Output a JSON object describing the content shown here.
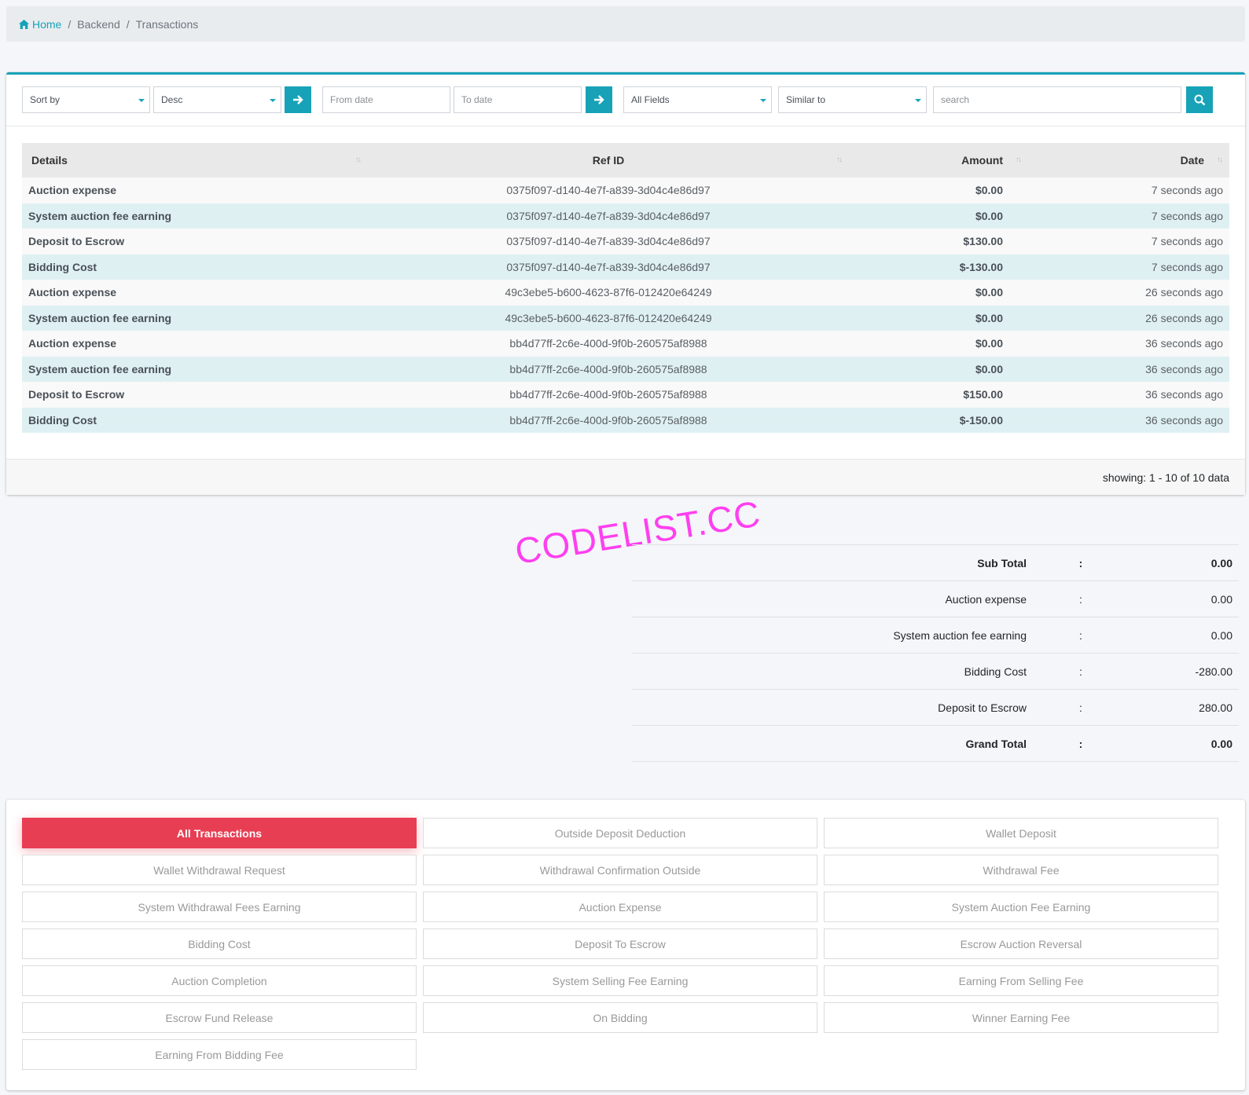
{
  "breadcrumb": {
    "home": "Home",
    "backend": "Backend",
    "current": "Transactions",
    "separator": "/"
  },
  "filters": {
    "sort_by": "Sort by",
    "order": "Desc",
    "from_date_placeholder": "From date",
    "to_date_placeholder": "To date",
    "field": "All Fields",
    "match": "Similar to",
    "search_placeholder": "search"
  },
  "table": {
    "headers": {
      "details": "Details",
      "ref_id": "Ref ID",
      "amount": "Amount",
      "date": "Date"
    },
    "rows": [
      {
        "details": "Auction expense",
        "ref_id": "0375f097-d140-4e7f-a839-3d04c4e86d97",
        "amount": "$0.00",
        "date": "7 seconds ago"
      },
      {
        "details": "System auction fee earning",
        "ref_id": "0375f097-d140-4e7f-a839-3d04c4e86d97",
        "amount": "$0.00",
        "date": "7 seconds ago"
      },
      {
        "details": "Deposit to Escrow",
        "ref_id": "0375f097-d140-4e7f-a839-3d04c4e86d97",
        "amount": "$130.00",
        "date": "7 seconds ago"
      },
      {
        "details": "Bidding Cost",
        "ref_id": "0375f097-d140-4e7f-a839-3d04c4e86d97",
        "amount": "$-130.00",
        "date": "7 seconds ago"
      },
      {
        "details": "Auction expense",
        "ref_id": "49c3ebe5-b600-4623-87f6-012420e64249",
        "amount": "$0.00",
        "date": "26 seconds ago"
      },
      {
        "details": "System auction fee earning",
        "ref_id": "49c3ebe5-b600-4623-87f6-012420e64249",
        "amount": "$0.00",
        "date": "26 seconds ago"
      },
      {
        "details": "Auction expense",
        "ref_id": "bb4d77ff-2c6e-400d-9f0b-260575af8988",
        "amount": "$0.00",
        "date": "36 seconds ago"
      },
      {
        "details": "System auction fee earning",
        "ref_id": "bb4d77ff-2c6e-400d-9f0b-260575af8988",
        "amount": "$0.00",
        "date": "36 seconds ago"
      },
      {
        "details": "Deposit to Escrow",
        "ref_id": "bb4d77ff-2c6e-400d-9f0b-260575af8988",
        "amount": "$150.00",
        "date": "36 seconds ago"
      },
      {
        "details": "Bidding Cost",
        "ref_id": "bb4d77ff-2c6e-400d-9f0b-260575af8988",
        "amount": "$-150.00",
        "date": "36 seconds ago"
      }
    ],
    "footer": "showing: 1 - 10 of 10 data"
  },
  "watermark": "CODELIST.CC",
  "summary": [
    {
      "label": "Sub Total",
      "colon": ":",
      "value": "0.00",
      "bold": true
    },
    {
      "label": "Auction expense",
      "colon": ":",
      "value": "0.00",
      "bold": false
    },
    {
      "label": "System auction fee earning",
      "colon": ":",
      "value": "0.00",
      "bold": false
    },
    {
      "label": "Bidding Cost",
      "colon": ":",
      "value": "-280.00",
      "bold": false
    },
    {
      "label": "Deposit to Escrow",
      "colon": ":",
      "value": "280.00",
      "bold": false
    },
    {
      "label": "Grand Total",
      "colon": ":",
      "value": "0.00",
      "bold": true
    }
  ],
  "transaction_types": [
    "All Transactions",
    "Outside Deposit Deduction",
    "Wallet Deposit",
    "Wallet Withdrawal Request",
    "Withdrawal Confirmation Outside",
    "Withdrawal Fee",
    "System Withdrawal Fees Earning",
    "Auction Expense",
    "System Auction Fee Earning",
    "Bidding Cost",
    "Deposit To Escrow",
    "Escrow Auction Reversal",
    "Auction Completion",
    "System Selling Fee Earning",
    "Earning From Selling Fee",
    "Escrow Fund Release",
    "On Bidding",
    "Winner Earning Fee",
    "Earning From Bidding Fee"
  ],
  "active_type": "All Transactions",
  "colors": {
    "accent": "#17a2b8",
    "active": "#e83e53",
    "watermark": "#ff3ff0"
  }
}
